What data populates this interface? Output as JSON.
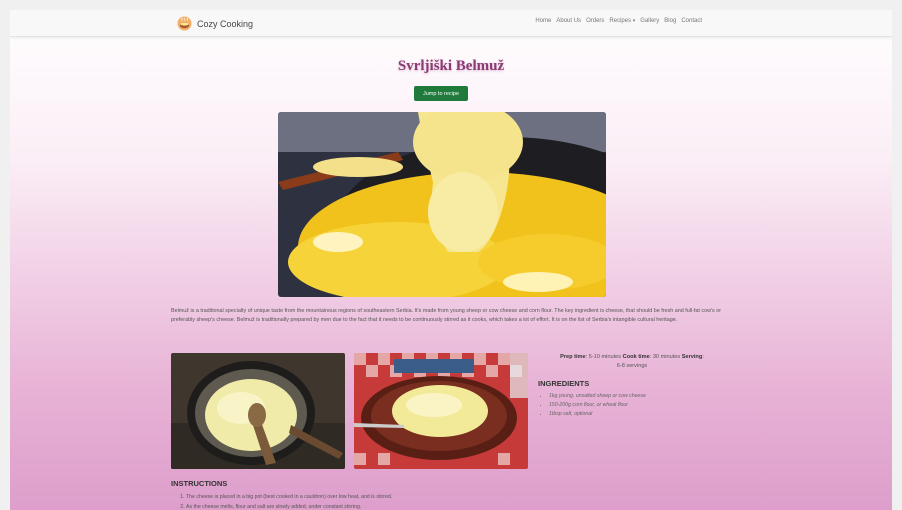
{
  "nav": {
    "brand": "Cozy Cooking",
    "links": [
      "Home",
      "About Us",
      "Orders",
      "Recipes",
      "Gallery",
      "Blog",
      "Contact"
    ]
  },
  "recipe": {
    "title": "Svrljiški Belmuž",
    "jump_label": "Jump to recipe",
    "intro": "Belmuž is a traditional specialty of unique taste from the mountainous regions of southeastern Serbia. It's made from young sheep or cow cheese and corn flour. The key ingredient is cheese, that should be fresh and full-fat cow's or preferably sheep's cheese. Belmuž is traditionally prepared by men due to the fact that it needs to be continuously stirred as it cooks, which takes a lot of effort. It is on the list of Serbia's intangible cultural heritage.",
    "meta": {
      "prep_label": "Prep time",
      "prep_value": "5-10 minutes",
      "cook_label": "Cook time",
      "cook_value": "30 minutes",
      "serving_label": "Serving",
      "serving_value": "6-8 servings"
    },
    "ingredients_title": "INGREDIENTS",
    "ingredients": [
      "1kg young, unsalted sheep or cow cheese",
      "150-200g corn flour, or wheat flour",
      "1tbsp salt, optional"
    ],
    "instructions_title": "INSTRUCTIONS",
    "instructions": [
      "The cheese is placed in a big pot (best cooked in a cauldron) over low heat, and is stirred.",
      "As the cheese melts, flour and salt are slowly added, under constant stirring."
    ]
  },
  "colors": {
    "accent": "#8a3a74",
    "button": "#1f7a3c",
    "gradient_bottom": "#dd9ecb"
  }
}
